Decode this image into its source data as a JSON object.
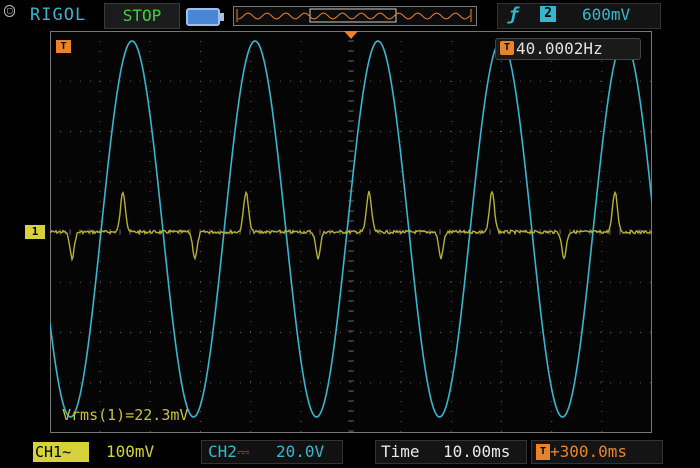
{
  "header": {
    "brand": "RIGOL",
    "run_state": "STOP",
    "trigger_slope_icon": "rising-edge-icon",
    "trigger_source": "2",
    "trigger_level": "600mV"
  },
  "screen": {
    "trigger_marker": "T",
    "frequency": "40.0002Hz",
    "ch1_marker": "1",
    "measurement": "Vrms(1)=22.3mV"
  },
  "footer": {
    "ch1_label": "CH1",
    "ch1_coupling_icon": "~",
    "ch1_scale": "100mV",
    "ch2_label": "CH2",
    "ch2_coupling_icon": "⎓",
    "ch2_scale": "20.0V",
    "time_label": "Time",
    "time_scale": "10.00ms",
    "trigger_offset": "+300.0ms"
  },
  "colors": {
    "ch1": "#c9c13a",
    "ch2": "#37b6d0",
    "accent": "#e8832a"
  }
}
